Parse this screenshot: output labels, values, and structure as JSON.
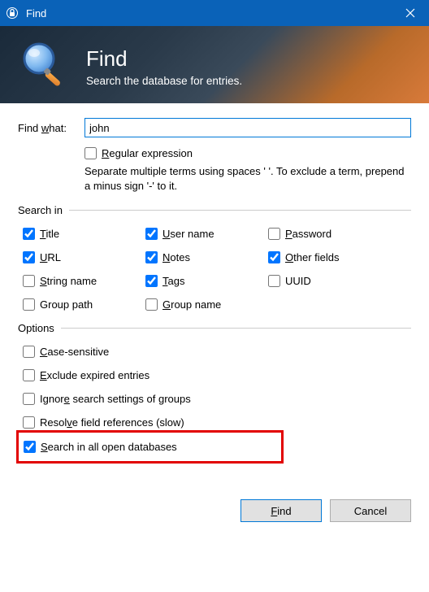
{
  "titlebar": {
    "title": "Find"
  },
  "banner": {
    "title": "Find",
    "subtitle": "Search the database for entries."
  },
  "findwhat": {
    "label": "Find what:",
    "value": "john"
  },
  "regex": {
    "label": "Regular expression",
    "checked": false
  },
  "helptext": "Separate multiple terms using spaces ' '. To exclude a term, prepend a minus sign '-' to it.",
  "searchin": {
    "legend": "Search in",
    "items": [
      {
        "key": "title",
        "label": "Title",
        "checked": true,
        "hot": "T"
      },
      {
        "key": "username",
        "label": "User name",
        "checked": true,
        "hot": "U"
      },
      {
        "key": "password",
        "label": "Password",
        "checked": false,
        "hot": "P"
      },
      {
        "key": "url",
        "label": "URL",
        "checked": true,
        "hot": "U"
      },
      {
        "key": "notes",
        "label": "Notes",
        "checked": true,
        "hot": "N"
      },
      {
        "key": "otherfields",
        "label": "Other fields",
        "checked": true,
        "hot": "O"
      },
      {
        "key": "stringname",
        "label": "String name",
        "checked": false,
        "hot": "S"
      },
      {
        "key": "tags",
        "label": "Tags",
        "checked": true,
        "hot": "T"
      },
      {
        "key": "uuid",
        "label": "UUID",
        "checked": false,
        "hot": ""
      },
      {
        "key": "grouppath",
        "label": "Group path",
        "checked": false,
        "hot": ""
      },
      {
        "key": "groupname",
        "label": "Group name",
        "checked": false,
        "hot": "G"
      }
    ]
  },
  "options": {
    "legend": "Options",
    "items": [
      {
        "key": "casesensitive",
        "label": "Case-sensitive",
        "checked": false,
        "hot": "C"
      },
      {
        "key": "excludeexpired",
        "label": "Exclude expired entries",
        "checked": false,
        "hot": "E"
      },
      {
        "key": "ignoresearchsettings",
        "label": "Ignore search settings of groups",
        "checked": false,
        "hot": "e"
      },
      {
        "key": "resolvefieldrefs",
        "label": "Resolve field references (slow)",
        "checked": false,
        "hot": "v"
      },
      {
        "key": "searchallopen",
        "label": "Search in all open databases",
        "checked": true,
        "hot": "S",
        "highlighted": true
      }
    ]
  },
  "buttons": {
    "find": "Find",
    "cancel": "Cancel"
  }
}
